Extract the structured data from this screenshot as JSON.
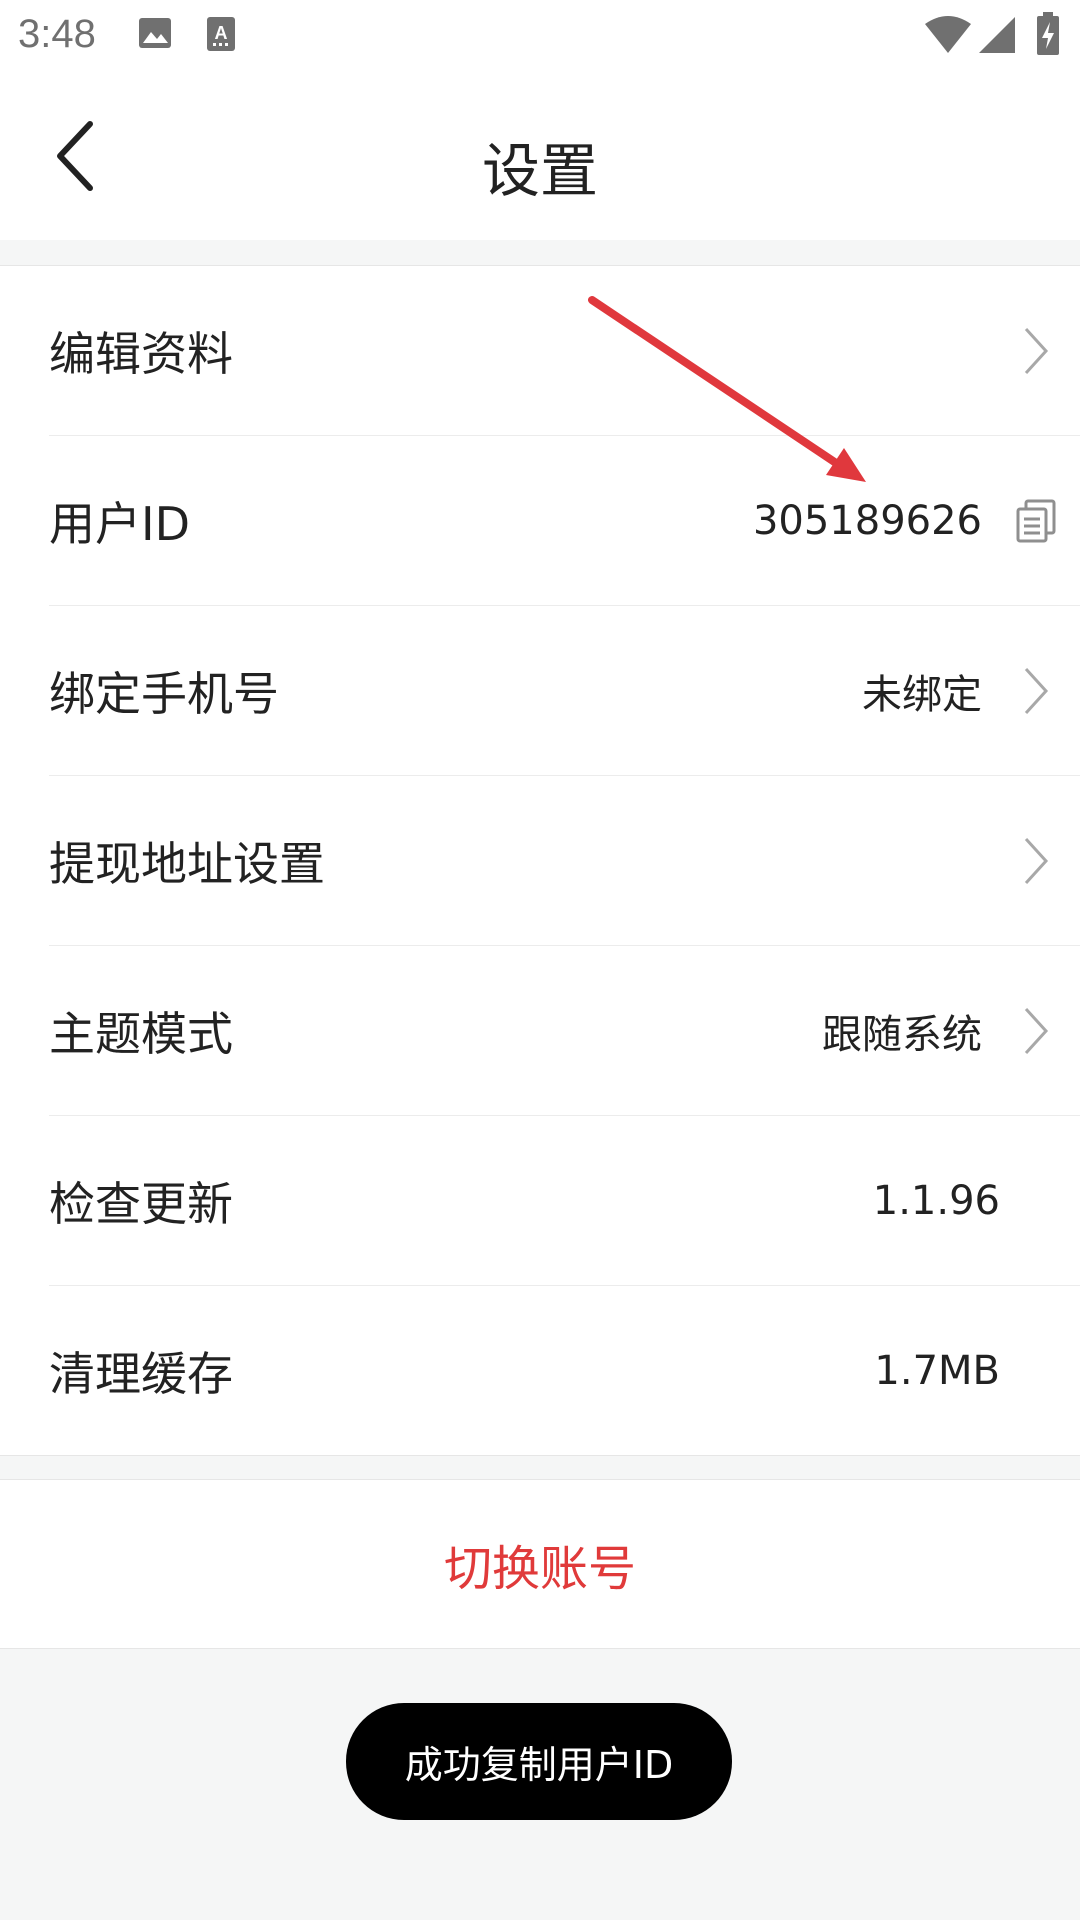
{
  "status_bar": {
    "time": "3:48",
    "icons": [
      "image-icon",
      "text-input-icon",
      "wifi-icon",
      "signal-icon",
      "battery-icon"
    ]
  },
  "header": {
    "title": "设置",
    "back_icon": "chevron-left-icon"
  },
  "settings": {
    "edit_profile": {
      "label": "编辑资料"
    },
    "user_id": {
      "label": "用户ID",
      "value": "305189626"
    },
    "phone": {
      "label": "绑定手机号",
      "value": "未绑定"
    },
    "withdraw": {
      "label": "提现地址设置"
    },
    "theme": {
      "label": "主题模式",
      "value": "跟随系统"
    },
    "update": {
      "label": "检查更新",
      "value": "1.1.96"
    },
    "cache": {
      "label": "清理缓存",
      "value": "1.7MB"
    }
  },
  "switch_account": {
    "label": "切换账号"
  },
  "toast": {
    "text": "成功复制用户ID"
  },
  "colors": {
    "accent_red": "#e03a3a",
    "background": "#f5f6f6",
    "annotation_arrow": "#e0383d"
  }
}
